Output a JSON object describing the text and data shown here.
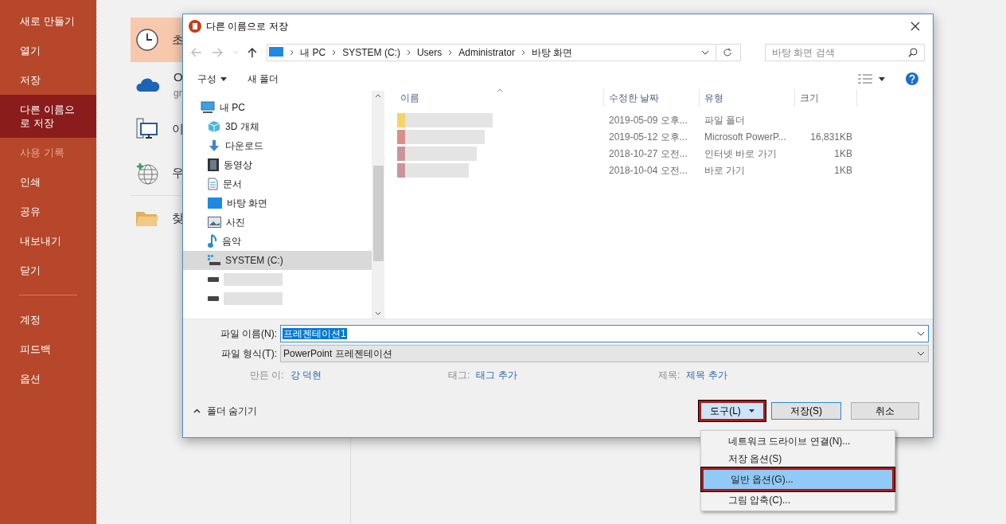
{
  "sidebar": {
    "items": [
      {
        "label": "새로 만들기",
        "selected": false,
        "disabled": false
      },
      {
        "label": "열기",
        "selected": false,
        "disabled": false
      },
      {
        "label": "저장",
        "selected": false,
        "disabled": false
      },
      {
        "label": "다른 이름으로 저장",
        "selected": true,
        "disabled": false
      },
      {
        "label": "사용 기록",
        "selected": false,
        "disabled": true
      },
      {
        "label": "인쇄",
        "selected": false,
        "disabled": false
      },
      {
        "label": "공유",
        "selected": false,
        "disabled": false
      },
      {
        "label": "내보내기",
        "selected": false,
        "disabled": false
      },
      {
        "label": "닫기",
        "selected": false,
        "disabled": false
      }
    ],
    "footer_items": [
      {
        "label": "계정",
        "selected": false,
        "disabled": false
      },
      {
        "label": "피드백",
        "selected": false,
        "disabled": false
      },
      {
        "label": "옵션",
        "selected": false,
        "disabled": false
      }
    ]
  },
  "locations": [
    {
      "kind": "recent",
      "label": "초",
      "selected": true
    },
    {
      "kind": "cloud",
      "label": "O",
      "sublabel": "gr",
      "selected": false
    },
    {
      "kind": "pc",
      "label": "이",
      "selected": false
    },
    {
      "kind": "web",
      "label": "우",
      "selected": false
    },
    {
      "kind": "browse",
      "label": "찾",
      "selected": false
    }
  ],
  "dialog": {
    "title": "다른 이름으로 저장",
    "address": [
      "내 PC",
      "SYSTEM (C:)",
      "Users",
      "Administrator",
      "바탕 화면"
    ],
    "search": {
      "placeholder": "바탕 화면 검색"
    },
    "toolbar": {
      "organize": "구성",
      "new_folder": "새 폴더"
    },
    "nav": [
      {
        "kind": "pc",
        "label": "내 PC",
        "selected": false
      },
      {
        "kind": "object",
        "label": "3D 개체",
        "selected": false
      },
      {
        "kind": "download",
        "label": "다운로드",
        "selected": false
      },
      {
        "kind": "video",
        "label": "동영상",
        "selected": false
      },
      {
        "kind": "document",
        "label": "문서",
        "selected": false
      },
      {
        "kind": "desktop",
        "label": "바탕 화면",
        "selected": false
      },
      {
        "kind": "picture",
        "label": "사진",
        "selected": false
      },
      {
        "kind": "music",
        "label": "음악",
        "selected": false
      },
      {
        "kind": "drive",
        "label": "SYSTEM (C:)",
        "selected": true
      },
      {
        "kind": "blurred-drive",
        "selected": false
      },
      {
        "kind": "blurred-drive",
        "selected": false
      }
    ],
    "columns": [
      "이름",
      "수정한 날짜",
      "유형",
      "크기"
    ],
    "rows": [
      {
        "modified": "2019-05-09 오후...",
        "type": "파일 폴더",
        "color": "#f5d36b"
      },
      {
        "modified": "2019-05-12 오후...",
        "type": "Microsoft PowerP...",
        "size": "16,831KB",
        "color": "#d9908a"
      },
      {
        "modified": "2018-10-27 오전...",
        "type": "인터넷 바로 가기",
        "size": "1KB",
        "color": "#c9959b"
      },
      {
        "modified": "2018-10-04 오전...",
        "type": "바로 가기",
        "size": "1KB",
        "color": "#c9959b"
      }
    ],
    "file_name": {
      "label": "파일 이름(N):",
      "value": "프레젠테이션1"
    },
    "file_type": {
      "label": "파일 형식(T):",
      "value": "PowerPoint 프레젠테이션"
    },
    "meta": [
      {
        "label": "만든 이:",
        "value": "강 덕현"
      },
      {
        "label": "태그:",
        "value": "태그 추가"
      },
      {
        "label": "제목:",
        "value": "제목 추가"
      }
    ],
    "hide_folders": "폴더 숨기기",
    "tools": {
      "label": "도구(L)",
      "highlighted": true
    },
    "save": "저장(S)",
    "cancel": "취소",
    "menu": [
      {
        "label": "네트워크 드라이브 연결(N)...",
        "selected": false,
        "highlighted": false
      },
      {
        "label": "저장 옵션(S)",
        "selected": false,
        "highlighted": false
      },
      {
        "label": "일반 옵션(G)...",
        "selected": true,
        "highlighted": true
      },
      {
        "label": "그림 압축(C)...",
        "selected": false,
        "highlighted": false
      }
    ]
  }
}
